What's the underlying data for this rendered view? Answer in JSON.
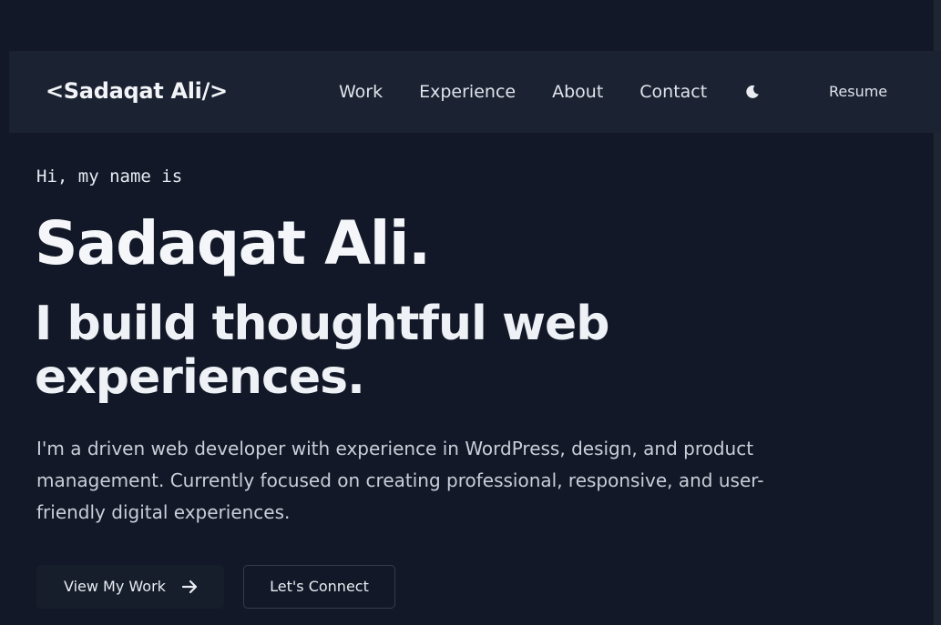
{
  "nav": {
    "logo": "<Sadaqat Ali/>",
    "links": [
      "Work",
      "Experience",
      "About",
      "Contact"
    ],
    "theme_icon": "moon-icon",
    "resume_label": "Resume"
  },
  "hero": {
    "intro": "Hi, my name is",
    "name": "Sadaqat Ali.",
    "tagline": "I build thoughtful web experiences.",
    "bio": "I'm a driven web developer with experience in WordPress, design, and product management. Currently focused on creating professional, responsive, and user-friendly digital experiences.",
    "primary_button": "View My Work",
    "primary_button_icon": "arrow-right-icon",
    "secondary_button": "Let's Connect"
  },
  "colors": {
    "background": "#121827",
    "navbar": "#1b2231",
    "text": "#e9edf2",
    "muted_text": "#c8cfd9"
  }
}
